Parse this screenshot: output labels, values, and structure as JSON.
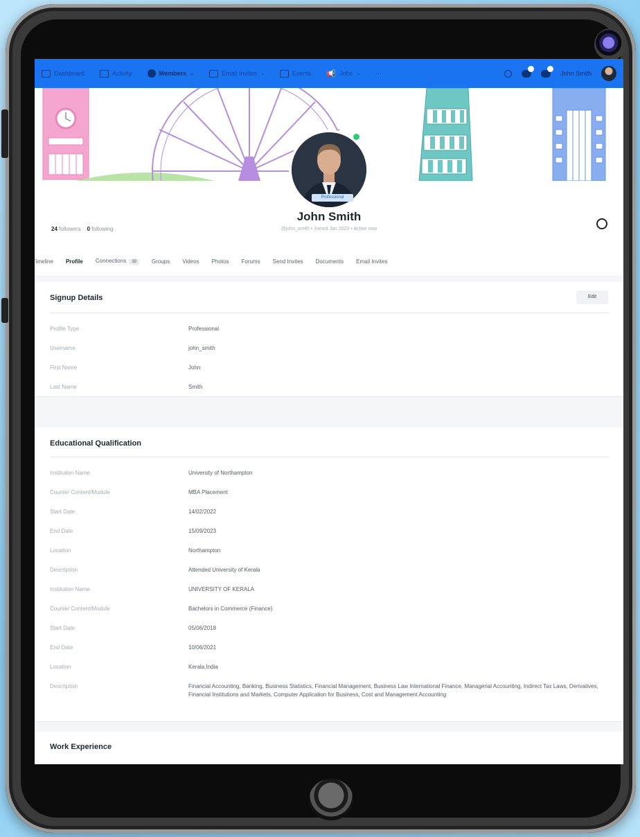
{
  "nav": {
    "items": [
      {
        "label": "Dashboard",
        "icon": "monitor-icon"
      },
      {
        "label": "Activity",
        "icon": "activity-icon"
      },
      {
        "label": "Members",
        "icon": "members-icon"
      },
      {
        "label": "Email Invites",
        "icon": "mail-icon"
      },
      {
        "label": "Events",
        "icon": "calendar-icon"
      },
      {
        "label": "Jobs",
        "icon": "megaphone-icon"
      }
    ],
    "active_index": 2,
    "user_name": "John Smith"
  },
  "profile": {
    "badge": "Professional",
    "name": "John Smith",
    "meta": "@john_smith • Joined Jan 2023 • Active now",
    "followers_count": "24",
    "followers_label": "followers",
    "following_count": "0",
    "following_label": "following"
  },
  "tabs": [
    {
      "label": "Timeline"
    },
    {
      "label": "Profile",
      "active": true
    },
    {
      "label": "Connections",
      "count": "39"
    },
    {
      "label": "Groups"
    },
    {
      "label": "Videos"
    },
    {
      "label": "Photos"
    },
    {
      "label": "Forums"
    },
    {
      "label": "Send Invites"
    },
    {
      "label": "Documents"
    },
    {
      "label": "Email Invites"
    }
  ],
  "signup": {
    "title": "Signup Details",
    "edit_label": "Edit",
    "rows": [
      {
        "k": "Profile Type",
        "v": "Professional"
      },
      {
        "k": "Username",
        "v": "john_smith"
      },
      {
        "k": "First Name",
        "v": "John"
      },
      {
        "k": "Last Name",
        "v": "Smith"
      }
    ]
  },
  "education": {
    "title": "Educational Qualification",
    "rows": [
      {
        "k": "Institution Name",
        "v": "University of Northampton"
      },
      {
        "k": "Course/ Content/Module",
        "v": "MBA Placement"
      },
      {
        "k": "Start Date",
        "v": "14/02/2022"
      },
      {
        "k": "End Date",
        "v": "15/09/2023"
      },
      {
        "k": "Location",
        "v": "Northampton"
      },
      {
        "k": "Description",
        "v": "Attended University of Kerala"
      },
      {
        "k": "Institution Name",
        "v": "UNIVERSITY OF KERALA"
      },
      {
        "k": "Course/ Content/Module",
        "v": "Bachelors in Commerce (Finance)"
      },
      {
        "k": "Start Date",
        "v": "05/06/2018"
      },
      {
        "k": "End Date",
        "v": "10/06/2021"
      },
      {
        "k": "Location",
        "v": "Kerala,India"
      },
      {
        "k": "Description",
        "v": "Financial Accounting, Banking,   Business Statistics, Financial Management, Business Law          International Finance, Managerial Accounting, Indirect Tax Laws, Derivatives, Financial Institutions and Markets, Computer Application for Business, Cost and Management Accounting"
      }
    ]
  },
  "work": {
    "title": "Work Experience"
  }
}
